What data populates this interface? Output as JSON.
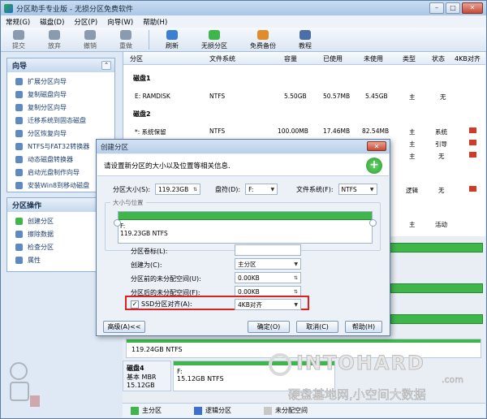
{
  "app": {
    "title": "分区助手专业版 - 无损分区免费软件"
  },
  "window_controls": {
    "minimize": "–",
    "maximize": "□",
    "close": "✕"
  },
  "menu": [
    "常规(G)",
    "磁盘(D)",
    "分区(P)",
    "向导(W)",
    "帮助(H)"
  ],
  "toolbar": {
    "commit": "提交",
    "discard": "放弃",
    "undo": "撤销",
    "redo": "重做",
    "refresh": "刷新",
    "lossless": "无损分区",
    "backup": "免费备份",
    "tutorial": "教程"
  },
  "wizard_panel": {
    "title": "向导",
    "items": [
      "扩展分区向导",
      "复制磁盘向导",
      "复制分区向导",
      "迁移系统到固态磁盘",
      "分区恢复向导",
      "NTFS与FAT32转换器",
      "动态磁盘转换器",
      "启动光盘制作向导",
      "安装Win8到移动磁盘"
    ]
  },
  "ops_panel": {
    "title": "分区操作",
    "items": [
      "创建分区",
      "擦除数据",
      "检查分区",
      "属性"
    ]
  },
  "grid": {
    "headers": [
      "分区",
      "文件系统",
      "容量",
      "已使用",
      "未使用",
      "类型",
      "状态",
      "4KB对齐"
    ],
    "disk1": "磁盘1",
    "disk2": "磁盘2",
    "rows": [
      {
        "partition": "E: RAMDISK",
        "fs": "NTFS",
        "capacity": "5.50GB",
        "used": "50.57MB",
        "unused": "5.45GB",
        "type": "主",
        "status": "无"
      },
      {
        "partition": "*: 系统保留",
        "fs": "NTFS",
        "capacity": "100.00MB",
        "used": "17.46MB",
        "unused": "82.54MB",
        "type": "主",
        "status": "系统"
      },
      {
        "type": "主",
        "status": "引导"
      },
      {
        "type": "主",
        "status": "无"
      },
      {
        "type": "逻辑",
        "status": "无"
      },
      {
        "type": "主",
        "status": "活动"
      }
    ]
  },
  "map": {
    "partition_size": "119.24GB NTFS",
    "disk4_title": "磁盘4",
    "disk4_type": "基本 MBR",
    "disk4_size": "15.12GB",
    "disk4_part_label": "F:",
    "disk4_part_size": "15.12GB NTFS"
  },
  "legend": {
    "primary": "主分区",
    "logical": "逻辑分区",
    "unallocated": "未分配空间"
  },
  "colors": {
    "primary": "#3fb64a",
    "logical": "#3b6fd1",
    "unallocated": "#c8c8c8"
  },
  "watermark": {
    "brand": "INTOHARD",
    "domain": ".com",
    "slogan": "硬盘基地网,小空间大数据"
  },
  "dialog": {
    "title": "创建分区",
    "desc": "请设置新分区的大小以及位置等相关信息.",
    "size_label": "分区大小(S):",
    "size_value": "119.23GB",
    "letter_label": "盘符(D):",
    "letter_value": "F:",
    "fs_label": "文件系统(F):",
    "fs_value": "NTFS",
    "group_label": "大小与位置",
    "bar_letter": "F:",
    "bar_size": "119.23GB NTFS",
    "volume_label": "分区卷标(L):",
    "volume_value": "",
    "create_as_label": "创建为(C):",
    "create_as_value": "主分区",
    "before_label": "分区前的未分配空间(U):",
    "before_value": "0.00KB",
    "after_label": "分区后的未分配空间(F):",
    "after_value": "0.00KB",
    "ssd_label": "SSD分区对齐(A):",
    "ssd_value": "4KB对齐",
    "ssd_checked": "✓",
    "advanced": "高级(A)<<",
    "ok": "确定(O)",
    "cancel": "取消(C)",
    "help": "帮助(H)"
  }
}
